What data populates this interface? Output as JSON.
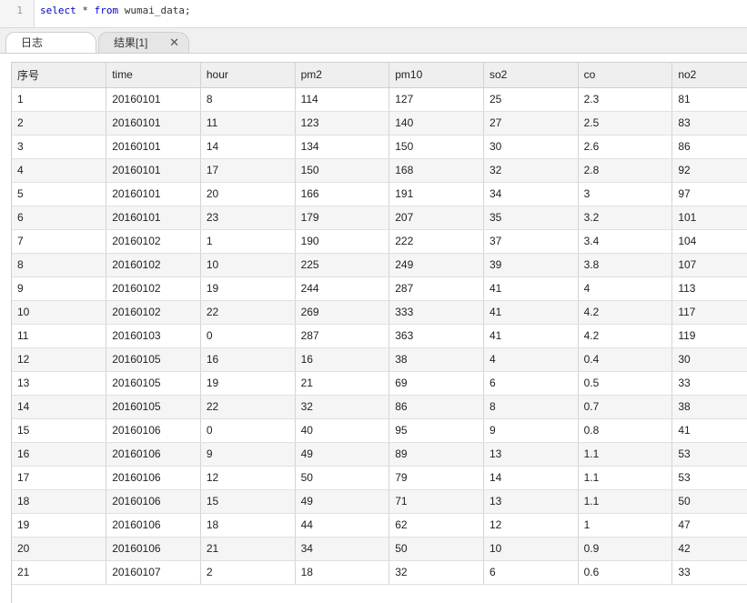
{
  "editor": {
    "line_number": "1",
    "code_kw1": "select",
    "code_mid": " * ",
    "code_kw2": "from",
    "code_rest": " wumai_data;"
  },
  "tabs": {
    "log_label": "日志",
    "result_label": "结果[1]",
    "close_glyph": "✕"
  },
  "grid": {
    "columns": [
      "序号",
      "time",
      "hour",
      "pm2",
      "pm10",
      "so2",
      "co",
      "no2"
    ],
    "rows": [
      [
        "1",
        "20160101",
        "8",
        "114",
        "127",
        "25",
        "2.3",
        "81"
      ],
      [
        "2",
        "20160101",
        "11",
        "123",
        "140",
        "27",
        "2.5",
        "83"
      ],
      [
        "3",
        "20160101",
        "14",
        "134",
        "150",
        "30",
        "2.6",
        "86"
      ],
      [
        "4",
        "20160101",
        "17",
        "150",
        "168",
        "32",
        "2.8",
        "92"
      ],
      [
        "5",
        "20160101",
        "20",
        "166",
        "191",
        "34",
        "3",
        "97"
      ],
      [
        "6",
        "20160101",
        "23",
        "179",
        "207",
        "35",
        "3.2",
        "101"
      ],
      [
        "7",
        "20160102",
        "1",
        "190",
        "222",
        "37",
        "3.4",
        "104"
      ],
      [
        "8",
        "20160102",
        "10",
        "225",
        "249",
        "39",
        "3.8",
        "107"
      ],
      [
        "9",
        "20160102",
        "19",
        "244",
        "287",
        "41",
        "4",
        "113"
      ],
      [
        "10",
        "20160102",
        "22",
        "269",
        "333",
        "41",
        "4.2",
        "117"
      ],
      [
        "11",
        "20160103",
        "0",
        "287",
        "363",
        "41",
        "4.2",
        "119"
      ],
      [
        "12",
        "20160105",
        "16",
        "16",
        "38",
        "4",
        "0.4",
        "30"
      ],
      [
        "13",
        "20160105",
        "19",
        "21",
        "69",
        "6",
        "0.5",
        "33"
      ],
      [
        "14",
        "20160105",
        "22",
        "32",
        "86",
        "8",
        "0.7",
        "38"
      ],
      [
        "15",
        "20160106",
        "0",
        "40",
        "95",
        "9",
        "0.8",
        "41"
      ],
      [
        "16",
        "20160106",
        "9",
        "49",
        "89",
        "13",
        "1.1",
        "53"
      ],
      [
        "17",
        "20160106",
        "12",
        "50",
        "79",
        "14",
        "1.1",
        "53"
      ],
      [
        "18",
        "20160106",
        "15",
        "49",
        "71",
        "13",
        "1.1",
        "50"
      ],
      [
        "19",
        "20160106",
        "18",
        "44",
        "62",
        "12",
        "1",
        "47"
      ],
      [
        "20",
        "20160106",
        "21",
        "34",
        "50",
        "10",
        "0.9",
        "42"
      ],
      [
        "21",
        "20160107",
        "2",
        "18",
        "32",
        "6",
        "0.6",
        "33"
      ]
    ]
  }
}
